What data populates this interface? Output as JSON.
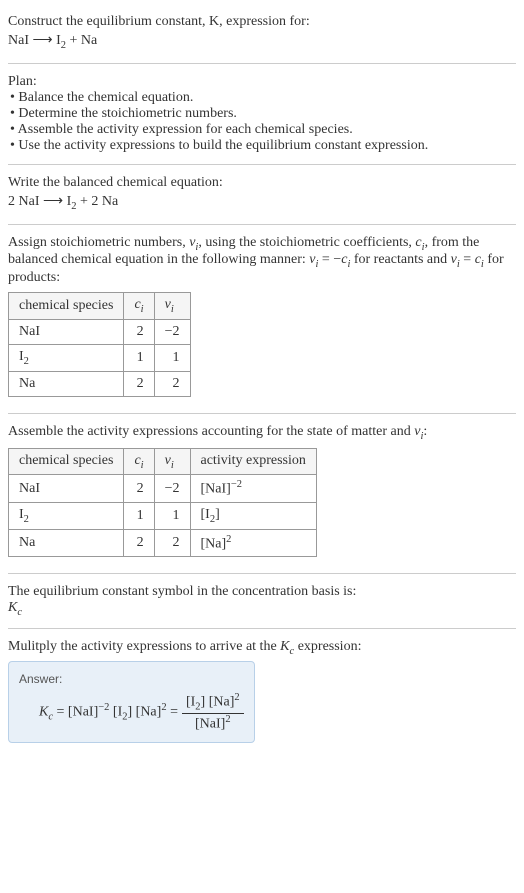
{
  "intro": {
    "line1": "Construct the equilibrium constant, K, expression for:",
    "line2_lhs": "NaI",
    "line2_arrow": "⟶",
    "line2_rhs1": "I",
    "line2_sub": "2",
    "line2_plus": " + Na"
  },
  "plan": {
    "title": "Plan:",
    "b1": "• Balance the chemical equation.",
    "b2": "• Determine the stoichiometric numbers.",
    "b3": "• Assemble the activity expression for each chemical species.",
    "b4": "• Use the activity expressions to build the equilibrium constant expression."
  },
  "balanced": {
    "title": "Write the balanced chemical equation:",
    "lhs": "2 NaI",
    "arrow": "⟶",
    "rhs_pre": "I",
    "rhs_sub": "2",
    "rhs_post": " + 2 Na"
  },
  "stoich": {
    "text_pre": "Assign stoichiometric numbers, ",
    "nu_i": "ν",
    "nu_i_sub": "i",
    "text_mid1": ", using the stoichiometric coefficients, ",
    "c_i": "c",
    "c_i_sub": "i",
    "text_mid2": ", from the balanced chemical equation in the following manner: ",
    "rel1_pre": "ν",
    "rel1_sub": "i",
    "rel1_eq": " = −",
    "rel1_c": "c",
    "rel1_csub": "i",
    "text_mid3": " for reactants and ",
    "rel2_pre": "ν",
    "rel2_sub": "i",
    "rel2_eq": " = ",
    "rel2_c": "c",
    "rel2_csub": "i",
    "text_end": " for products:"
  },
  "table1": {
    "h1": "chemical species",
    "h2_c": "c",
    "h2_sub": "i",
    "h3_nu": "ν",
    "h3_sub": "i",
    "r1c1": "NaI",
    "r1c2": "2",
    "r1c3": "−2",
    "r2c1_pre": "I",
    "r2c1_sub": "2",
    "r2c2": "1",
    "r2c3": "1",
    "r3c1": "Na",
    "r3c2": "2",
    "r3c3": "2"
  },
  "assemble": {
    "text_pre": "Assemble the activity expressions accounting for the state of matter and ",
    "nu": "ν",
    "nu_sub": "i",
    "text_end": ":"
  },
  "table2": {
    "h1": "chemical species",
    "h2_c": "c",
    "h2_sub": "i",
    "h3_nu": "ν",
    "h3_sub": "i",
    "h4": "activity expression",
    "r1c1": "NaI",
    "r1c2": "2",
    "r1c3": "−2",
    "r1c4_pre": "[NaI]",
    "r1c4_sup": "−2",
    "r2c1_pre": "I",
    "r2c1_sub": "2",
    "r2c2": "1",
    "r2c3": "1",
    "r2c4_pre": "[I",
    "r2c4_sub": "2",
    "r2c4_post": "]",
    "r3c1": "Na",
    "r3c2": "2",
    "r3c3": "2",
    "r3c4_pre": "[Na]",
    "r3c4_sup": "2"
  },
  "symbol": {
    "text": "The equilibrium constant symbol in the concentration basis is:",
    "kc_k": "K",
    "kc_sub": "c"
  },
  "multiply": {
    "text_pre": "Mulitply the activity expressions to arrive at the ",
    "kc_k": "K",
    "kc_sub": "c",
    "text_end": " expression:"
  },
  "answer": {
    "label": "Answer:",
    "kc_k": "K",
    "kc_sub": "c",
    "eq1": " = ",
    "t1_pre": "[NaI]",
    "t1_sup": "−2",
    "t2_pre": " [I",
    "t2_sub": "2",
    "t2_post": "]",
    "t3_pre": " [Na]",
    "t3_sup": "2",
    "eq2": " = ",
    "num_pre": "[I",
    "num_sub": "2",
    "num_mid": "] [Na]",
    "num_sup": "2",
    "den_pre": "[NaI]",
    "den_sup": "2"
  }
}
